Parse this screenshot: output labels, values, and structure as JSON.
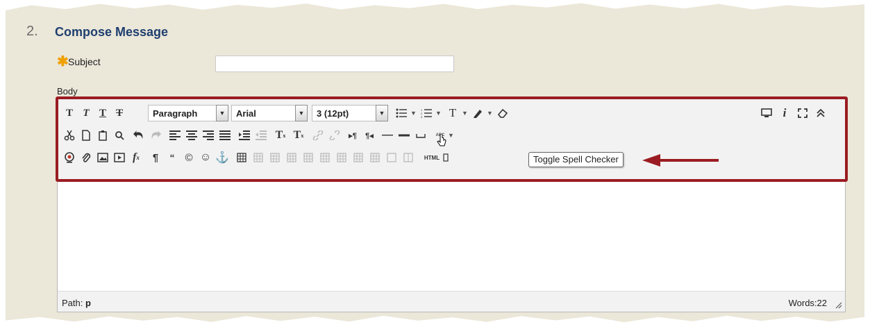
{
  "section": {
    "number": "2.",
    "title": "Compose Message"
  },
  "subject": {
    "required_marker": "✱",
    "label": "Subject",
    "value": ""
  },
  "body": {
    "label": "Body"
  },
  "toolbar": {
    "paragraph_select": "Paragraph",
    "font_select": "Arial",
    "size_select": "3 (12pt)",
    "html_label": "HTML",
    "spell_glyph": "ABC"
  },
  "tooltip": {
    "text": "Toggle Spell Checker"
  },
  "status": {
    "path_label": "Path:",
    "path_value": "p",
    "words": "Words:22"
  },
  "colors": {
    "highlight": "#9a1c22",
    "title": "#1f3f6f",
    "star": "#f0a000"
  }
}
